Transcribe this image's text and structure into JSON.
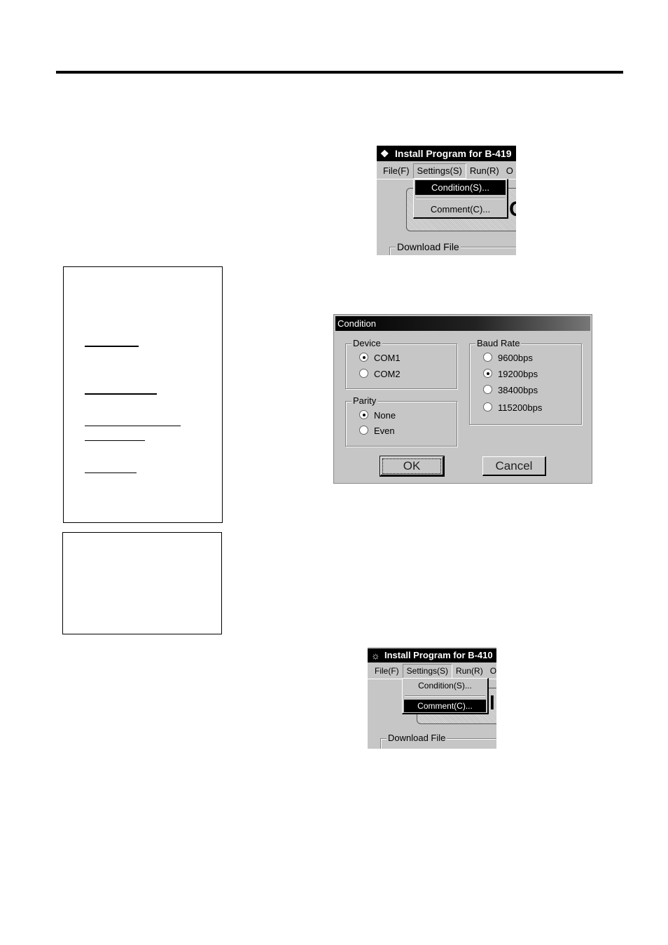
{
  "top_screenshot": {
    "title": "Install Program for B-419",
    "menu": [
      "File(F)",
      "Settings(S)",
      "Run(R)",
      "O"
    ],
    "dropdown": [
      "Condition(S)...",
      "Comment(C)..."
    ],
    "highlighted": "Condition(S)...",
    "behind_glyph": "C",
    "group_label": "Download File"
  },
  "condition_dialog": {
    "title": "Condition",
    "device": {
      "label": "Device",
      "options": [
        "COM1",
        "COM2"
      ],
      "selected": "COM1"
    },
    "parity": {
      "label": "Parity",
      "options": [
        "None",
        "Even"
      ],
      "selected": "None"
    },
    "baud_rate": {
      "label": "Baud Rate",
      "options": [
        "9600bps",
        "19200bps",
        "38400bps",
        "115200bps"
      ],
      "selected": "19200bps"
    },
    "ok_label": "OK",
    "cancel_label": "Cancel"
  },
  "bottom_screenshot": {
    "title": "Install Program for B-410",
    "menu": [
      "File(F)",
      "Settings(S)",
      "Run(R)",
      "O"
    ],
    "dropdown": [
      "Condition(S)...",
      "Comment(C)..."
    ],
    "highlighted": "Comment(C)...",
    "behind_glyph": "l",
    "group_label": "Download File"
  }
}
